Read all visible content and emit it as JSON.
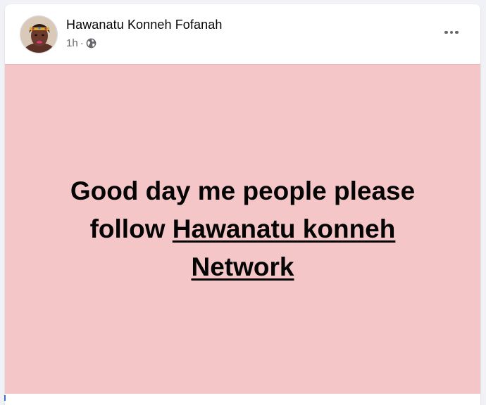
{
  "post": {
    "author_name": "Hawanatu Konneh Fofanah",
    "timestamp": "1h",
    "separator": "·",
    "audience_icon": "globe-icon",
    "menu_icon": "more-options-icon",
    "text_before_link": "Good day me people please follow ",
    "link_text": "Hawanatu konneh Network",
    "background_color": "#f4c6c7"
  }
}
